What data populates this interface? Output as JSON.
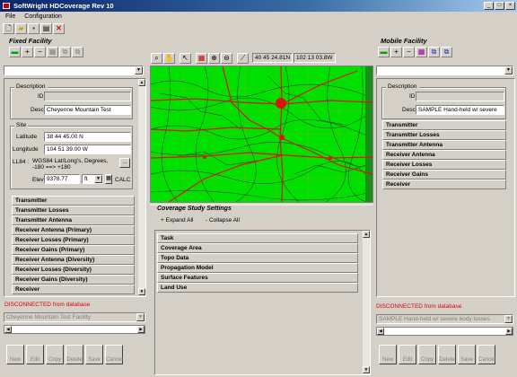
{
  "window": {
    "title": "SoftWright HDCoverage Rev 10"
  },
  "menu": [
    "File",
    "Configuration"
  ],
  "fixed": {
    "title": "Fixed Facility",
    "description": {
      "legend": "Description",
      "id_label": "ID",
      "desc_label": "Desc",
      "desc_value": "Cheyenne Mountain Test"
    },
    "site": {
      "legend": "Site",
      "lat_label": "Latitude",
      "lat_value": "38 44 45.00 N",
      "lon_label": "Longitude",
      "lon_value": "104 51 39.00 W",
      "ll84_label": "LL84 :",
      "ll84_value": "WGS84 Lat/Long's, Degrees, -180 ==> +180",
      "elev_label": "Elev",
      "elev_value": "9378.77",
      "elev_unit": "ft",
      "calc_label": "CALC"
    },
    "sections": [
      "Transmitter",
      "Transmitter Losses",
      "Transmitter Antenna",
      "Receiver Antenna (Primary)",
      "Receiver Losses (Primary)",
      "Receiver Gains (Primary)",
      "Receiver Antenna (Diversity)",
      "Receiver Losses (Diversity)",
      "Receiver Gains (Diversity)",
      "Receiver"
    ],
    "status": "DISCONNECTED from database",
    "db_combo": "Cheyenne Mountain Test Facility"
  },
  "map": {
    "coord_lat": "40 45 24.81N",
    "coord_lon": "102 13 03.8W"
  },
  "coverage": {
    "title": "Coverage Study Settings",
    "expand_label": "Expand All",
    "collapse_label": "Collapse All",
    "sections": [
      "Task",
      "Coverage Area",
      "Topo Data",
      "Propagation Model",
      "Surface Features",
      "Land Use"
    ]
  },
  "mobile": {
    "title": "Mobile Facility",
    "description": {
      "legend": "Description",
      "id_label": "ID",
      "desc_label": "Desc",
      "desc_value": "SAMPLE Hand-held w/ severe"
    },
    "sections": [
      "Transmitter",
      "Transmitter Losses",
      "Transmitter Antenna",
      "Receiver Antenna",
      "Receiver Losses",
      "Receiver Gains",
      "Receiver"
    ],
    "status": "DISCONNECTED from database",
    "db_combo": "SAMPLE Hand-held w/ severe body losses"
  },
  "buttons": [
    "New",
    "Edit",
    "Copy",
    "Delete",
    "Save",
    "Cancel"
  ],
  "colors": {
    "map_green": "#00e000",
    "road_red": "#e01010",
    "status_red": "#e00000",
    "title_blue": "#0a246a"
  }
}
